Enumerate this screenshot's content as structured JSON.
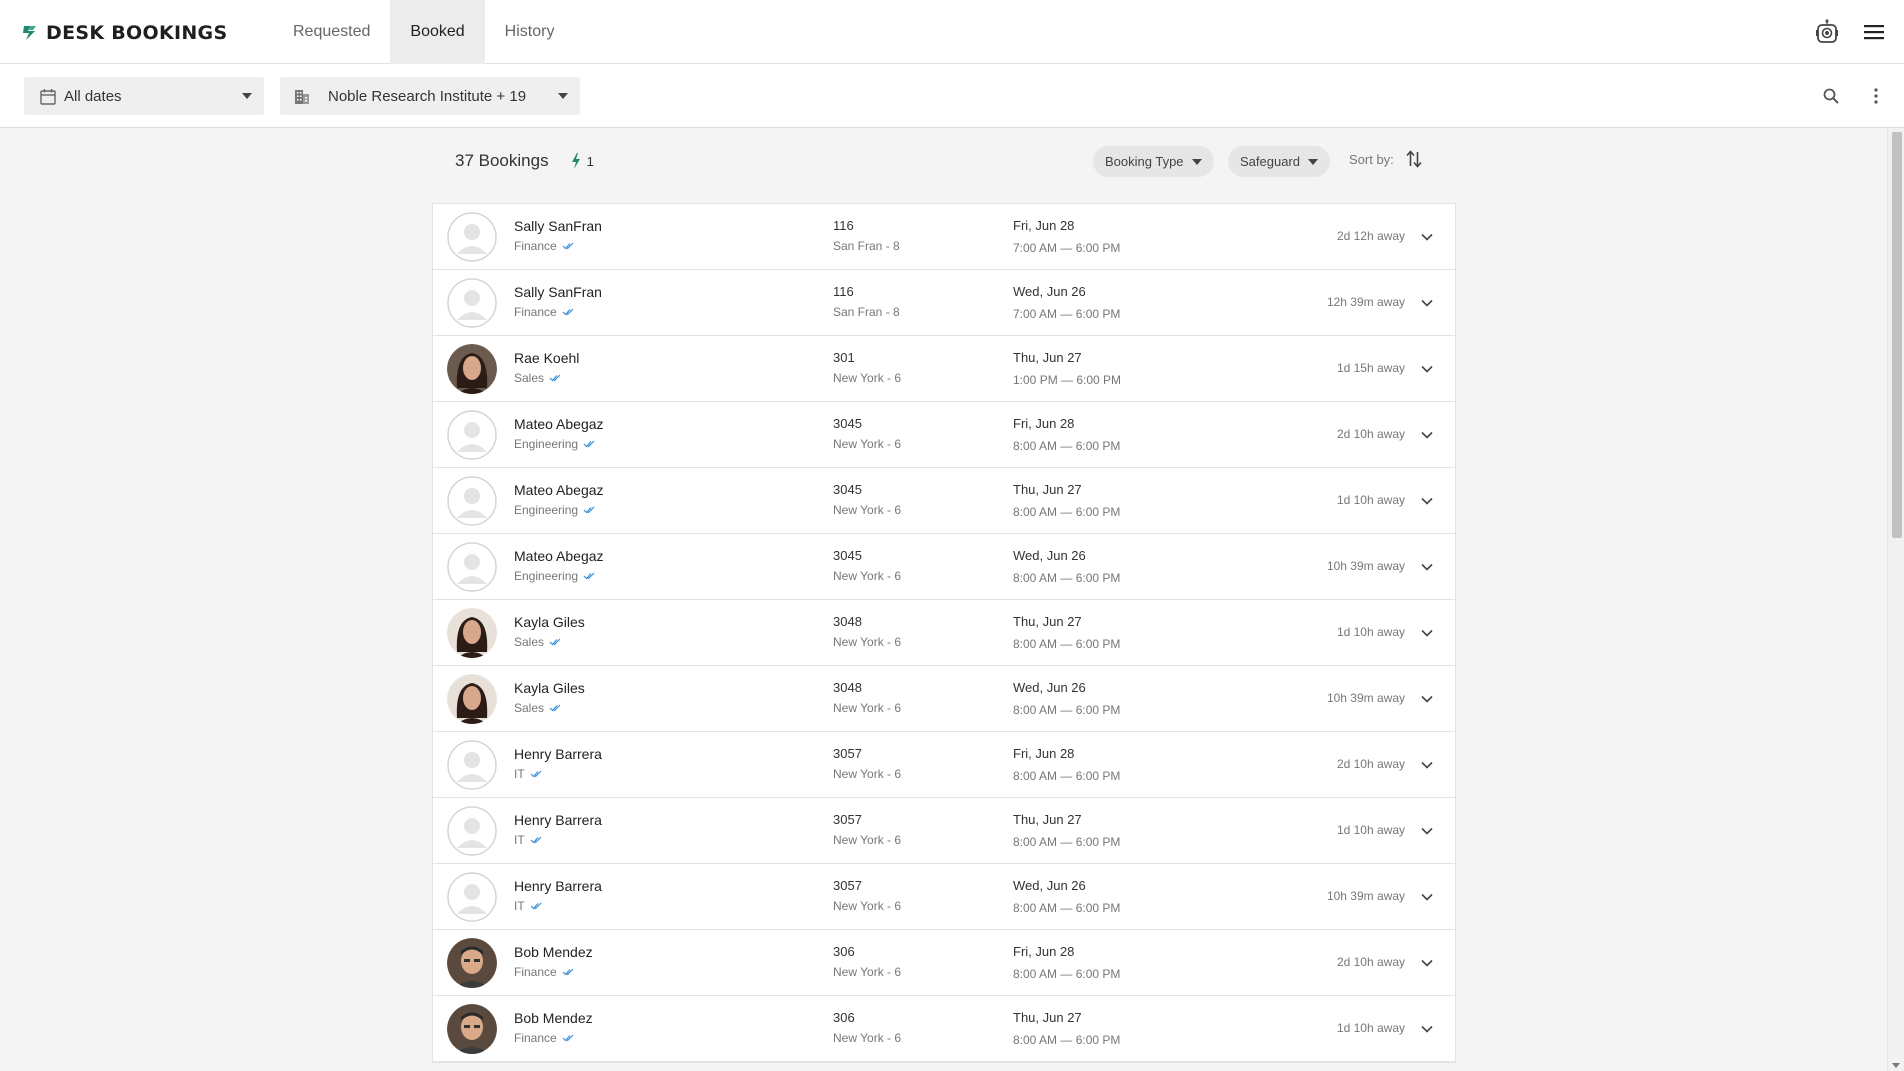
{
  "app": {
    "title": "DESK BOOKINGS"
  },
  "tabs": [
    {
      "label": "Requested",
      "active": false
    },
    {
      "label": "Booked",
      "active": true
    },
    {
      "label": "History",
      "active": false
    }
  ],
  "filters": {
    "date": {
      "value": "All dates",
      "icon": "calendar-icon"
    },
    "location": {
      "value": "Noble Research Institute + 19",
      "icon": "building-icon"
    }
  },
  "summary": {
    "count_label": "37 Bookings",
    "flash_count": "1"
  },
  "chips": {
    "booking_type": "Booking Type",
    "safeguard": "Safeguard"
  },
  "sort": {
    "label": "Sort by:"
  },
  "colors": {
    "accent": "#1f8a70",
    "check": "#3a8fd6",
    "active_tab_bg": "#ececec"
  },
  "bookings": [
    {
      "name": "Sally SanFran",
      "dept": "Finance",
      "desk": "116",
      "location": "San Fran - 8",
      "day": "Fri, Jun 28",
      "time": "7:00 AM — 6:00 PM",
      "away": "2d 12h away",
      "avatar": "placeholder"
    },
    {
      "name": "Sally SanFran",
      "dept": "Finance",
      "desk": "116",
      "location": "San Fran - 8",
      "day": "Wed, Jun 26",
      "time": "7:00 AM — 6:00 PM",
      "away": "12h 39m away",
      "avatar": "placeholder"
    },
    {
      "name": "Rae Koehl",
      "dept": "Sales",
      "desk": "301",
      "location": "New York - 6",
      "day": "Thu, Jun 27",
      "time": "1:00 PM — 6:00 PM",
      "away": "1d 15h away",
      "avatar": "photo-woman-dark"
    },
    {
      "name": "Mateo Abegaz",
      "dept": "Engineering",
      "desk": "3045",
      "location": "New York - 6",
      "day": "Fri, Jun 28",
      "time": "8:00 AM — 6:00 PM",
      "away": "2d 10h away",
      "avatar": "placeholder"
    },
    {
      "name": "Mateo Abegaz",
      "dept": "Engineering",
      "desk": "3045",
      "location": "New York - 6",
      "day": "Thu, Jun 27",
      "time": "8:00 AM — 6:00 PM",
      "away": "1d 10h away",
      "avatar": "placeholder"
    },
    {
      "name": "Mateo Abegaz",
      "dept": "Engineering",
      "desk": "3045",
      "location": "New York - 6",
      "day": "Wed, Jun 26",
      "time": "8:00 AM — 6:00 PM",
      "away": "10h 39m away",
      "avatar": "placeholder"
    },
    {
      "name": "Kayla Giles",
      "dept": "Sales",
      "desk": "3048",
      "location": "New York - 6",
      "day": "Thu, Jun 27",
      "time": "8:00 AM — 6:00 PM",
      "away": "1d 10h away",
      "avatar": "photo-woman"
    },
    {
      "name": "Kayla Giles",
      "dept": "Sales",
      "desk": "3048",
      "location": "New York - 6",
      "day": "Wed, Jun 26",
      "time": "8:00 AM — 6:00 PM",
      "away": "10h 39m away",
      "avatar": "photo-woman"
    },
    {
      "name": "Henry Barrera",
      "dept": "IT",
      "desk": "3057",
      "location": "New York - 6",
      "day": "Fri, Jun 28",
      "time": "8:00 AM — 6:00 PM",
      "away": "2d 10h away",
      "avatar": "placeholder"
    },
    {
      "name": "Henry Barrera",
      "dept": "IT",
      "desk": "3057",
      "location": "New York - 6",
      "day": "Thu, Jun 27",
      "time": "8:00 AM — 6:00 PM",
      "away": "1d 10h away",
      "avatar": "placeholder"
    },
    {
      "name": "Henry Barrera",
      "dept": "IT",
      "desk": "3057",
      "location": "New York - 6",
      "day": "Wed, Jun 26",
      "time": "8:00 AM — 6:00 PM",
      "away": "10h 39m away",
      "avatar": "placeholder"
    },
    {
      "name": "Bob Mendez",
      "dept": "Finance",
      "desk": "306",
      "location": "New York - 6",
      "day": "Fri, Jun 28",
      "time": "8:00 AM — 6:00 PM",
      "away": "2d 10h away",
      "avatar": "photo-man"
    },
    {
      "name": "Bob Mendez",
      "dept": "Finance",
      "desk": "306",
      "location": "New York - 6",
      "day": "Thu, Jun 27",
      "time": "8:00 AM — 6:00 PM",
      "away": "1d 10h away",
      "avatar": "photo-man"
    }
  ]
}
